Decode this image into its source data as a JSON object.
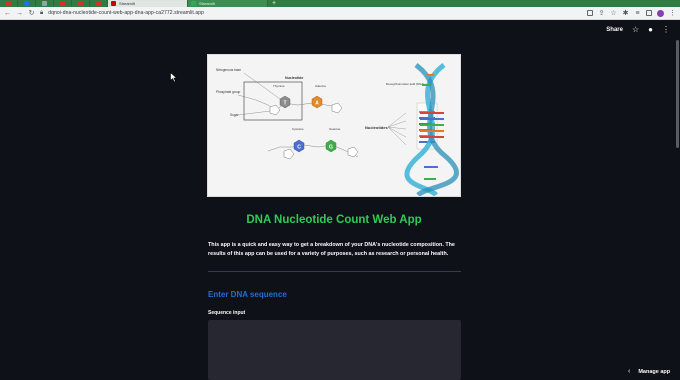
{
  "browser": {
    "tabs": [
      {
        "color": "#d93025"
      },
      {
        "color": "#1a73e8"
      },
      {
        "color": "#9aa0a6"
      },
      {
        "color": "#d93025"
      },
      {
        "color": "#d93025"
      },
      {
        "color": "#d93025"
      },
      {
        "title": "Streamlit",
        "color": "#cc0000",
        "active": true
      },
      {
        "title": "Streamlit",
        "color": "#34a853",
        "active": false
      }
    ],
    "new_tab": "+",
    "url": "dqnoi-dna-nucleotide-count-web-app-dna-app-ca2772.streamlit.app"
  },
  "st_header": {
    "share": "Share"
  },
  "diagram": {
    "labels": {
      "nitrogenous_base": "Nitrogenous base",
      "nucleotide": "Nucleotide",
      "phosphate_group": "Phosphate group",
      "sugar": "Sugar",
      "thymine": "Thymine",
      "adenine": "Adenine",
      "cytosine": "Cytosine",
      "guanine": "Guanine",
      "nucleotides": "Nucleotides",
      "deoxyribose": "Deoxyribonucleic acid (DNA)",
      "base_pairs": "Base Pairs"
    },
    "bases": {
      "t": "T",
      "a": "A",
      "c": "C",
      "g": "G"
    }
  },
  "main": {
    "title": "DNA Nucleotide Count Web App",
    "description": "This app is a quick and easy way to get a breakdown of your DNA's nucleotide composition. The results of this app can be used for a variety of purposes, such as research or personal health.",
    "subheader": "Enter DNA sequence",
    "input_label": "Sequence input",
    "input_value": ""
  },
  "footer": {
    "manage_app": "Manage app"
  },
  "colors": {
    "background": "#0e1117",
    "title": "#2ecc55",
    "subheader": "#1f6fd6",
    "input_bg": "#262730"
  }
}
